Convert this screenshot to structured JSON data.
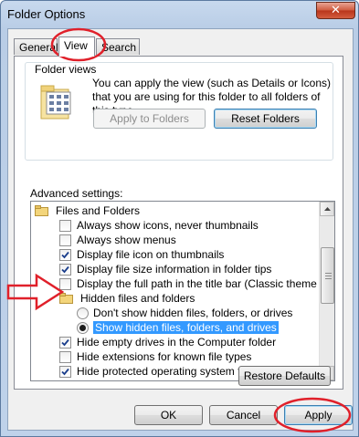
{
  "window": {
    "title": "Folder Options",
    "close_glyph": "✕"
  },
  "tabs": [
    {
      "label": "General"
    },
    {
      "label": "View",
      "active": true
    },
    {
      "label": "Search"
    }
  ],
  "folder_views": {
    "title": "Folder views",
    "description": "You can apply the view (such as Details or Icons) that you are using for this folder to all folders of this type.",
    "apply_to_folders": "Apply to Folders",
    "reset_folders": "Reset Folders",
    "icon": "folder-views-icon"
  },
  "advanced": {
    "label": "Advanced settings:",
    "items": [
      {
        "type": "folder",
        "label": "Files and Folders"
      },
      {
        "type": "checkbox",
        "label": "Always show icons, never thumbnails",
        "checked": false
      },
      {
        "type": "checkbox",
        "label": "Always show menus",
        "checked": false
      },
      {
        "type": "checkbox",
        "label": "Display file icon on thumbnails",
        "checked": true
      },
      {
        "type": "checkbox",
        "label": "Display file size information in folder tips",
        "checked": true
      },
      {
        "type": "checkbox",
        "label": "Display the full path in the title bar (Classic theme only)",
        "checked": false
      },
      {
        "type": "folder",
        "label": "Hidden files and folders"
      },
      {
        "type": "radio",
        "label": "Don't show hidden files, folders, or drives",
        "checked": false
      },
      {
        "type": "radio",
        "label": "Show hidden files, folders, and drives",
        "checked": true,
        "selected": true
      },
      {
        "type": "checkbox",
        "label": "Hide empty drives in the Computer folder",
        "checked": true
      },
      {
        "type": "checkbox",
        "label": "Hide extensions for known file types",
        "checked": false
      },
      {
        "type": "checkbox",
        "label": "Hide protected operating system files (Recommended)",
        "checked": true
      }
    ]
  },
  "restore_defaults": "Restore Defaults",
  "footer": {
    "ok": "OK",
    "cancel": "Cancel",
    "apply": "Apply"
  },
  "colors": {
    "annotation": "#e0202a",
    "selection": "#3399ff"
  }
}
